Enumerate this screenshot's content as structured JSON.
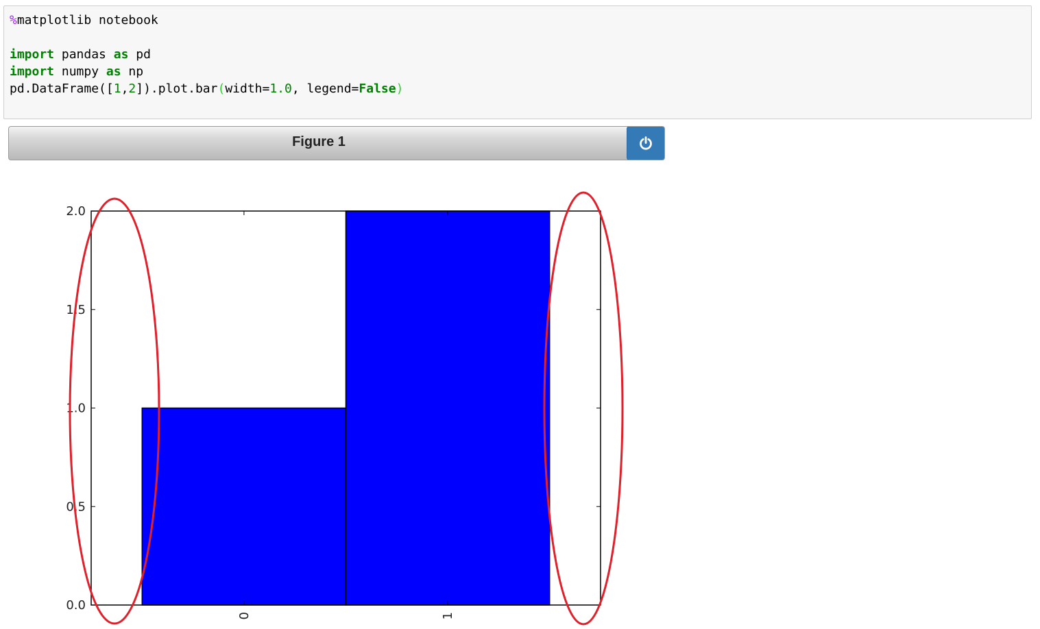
{
  "code_cell": {
    "lines": [
      [
        {
          "t": "%",
          "c": "magic"
        },
        {
          "t": "matplotlib notebook",
          "c": ""
        }
      ],
      [],
      [
        {
          "t": "import",
          "c": "kw"
        },
        {
          "t": " pandas ",
          "c": ""
        },
        {
          "t": "as",
          "c": "kw"
        },
        {
          "t": " pd",
          "c": ""
        }
      ],
      [
        {
          "t": "import",
          "c": "kw"
        },
        {
          "t": " numpy ",
          "c": ""
        },
        {
          "t": "as",
          "c": "kw"
        },
        {
          "t": " np",
          "c": ""
        }
      ],
      [
        {
          "t": "pd.DataFrame([",
          "c": ""
        },
        {
          "t": "1",
          "c": "num"
        },
        {
          "t": ",",
          "c": ""
        },
        {
          "t": "2",
          "c": "num"
        },
        {
          "t": "]).plot.bar",
          "c": ""
        },
        {
          "t": "(",
          "c": "paren"
        },
        {
          "t": "width=",
          "c": ""
        },
        {
          "t": "1.0",
          "c": "num"
        },
        {
          "t": ", legend=",
          "c": ""
        },
        {
          "t": "False",
          "c": "kw"
        },
        {
          "t": ")",
          "c": "paren"
        }
      ]
    ]
  },
  "figure": {
    "title": "Figure 1",
    "power_icon": "power-icon"
  },
  "chart_data": {
    "type": "bar",
    "categories": [
      "0",
      "1"
    ],
    "values": [
      1,
      2
    ],
    "bar_width": 1.0,
    "xlim": [
      -0.75,
      1.75
    ],
    "ylim": [
      0,
      2.0
    ],
    "yticks": [
      "0.0",
      "0.5",
      "1.0",
      "1.5",
      "2.0"
    ],
    "xtick_rotation": "vertical",
    "legend": false,
    "grid": false,
    "bar_color": "#0000ff",
    "annotations": [
      {
        "shape": "ellipse",
        "color": "#e0202a",
        "around": "left margin gap"
      },
      {
        "shape": "ellipse",
        "color": "#e0202a",
        "around": "right margin gap"
      }
    ]
  }
}
